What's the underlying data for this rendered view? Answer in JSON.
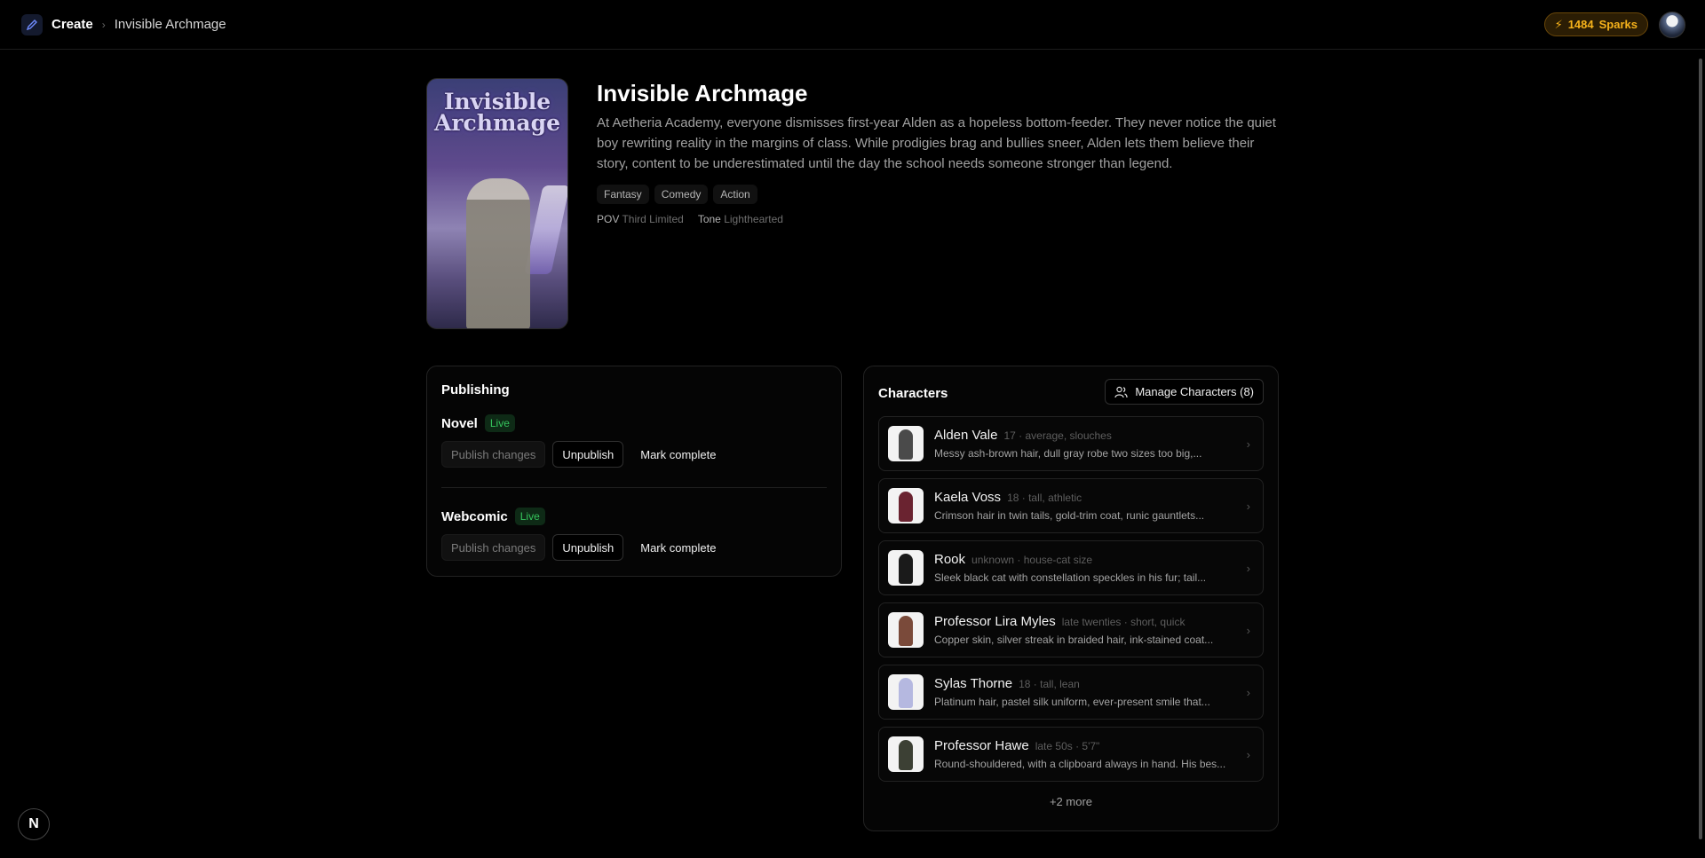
{
  "header": {
    "breadcrumb_root": "Create",
    "breadcrumb_sep": "›",
    "breadcrumb_current": "Invisible Archmage",
    "sparks_count": "1484",
    "sparks_label": "Sparks",
    "spark_color": "#f6b21b"
  },
  "story": {
    "cover_title_line1": "Invisible",
    "cover_title_line2": "Archmage",
    "title": "Invisible Archmage",
    "description": "At Aetheria Academy, everyone dismisses first-year Alden as a hopeless bottom-feeder. They never notice the quiet boy rewriting reality in the margins of class. While prodigies brag and bullies sneer, Alden lets them believe their story, content to be underestimated until the day the school needs someone stronger than legend.",
    "tags": [
      "Fantasy",
      "Comedy",
      "Action"
    ],
    "pov_label": "POV",
    "pov_value": "Third Limited",
    "tone_label": "Tone",
    "tone_value": "Lighthearted"
  },
  "publishing": {
    "title": "Publishing",
    "live_color": "#35c45c",
    "rows": [
      {
        "name": "Novel",
        "status": "Live",
        "publish": "Publish changes",
        "unpublish": "Unpublish",
        "complete": "Mark complete"
      },
      {
        "name": "Webcomic",
        "status": "Live",
        "publish": "Publish changes",
        "unpublish": "Unpublish",
        "complete": "Mark complete"
      }
    ]
  },
  "characters": {
    "title": "Characters",
    "manage_label": "Manage Characters (8)",
    "more_label": "+2 more",
    "items": [
      {
        "name": "Alden Vale",
        "attrs": "17 · average, slouches",
        "desc": "Messy ash-brown hair, dull gray robe two sizes too big,..."
      },
      {
        "name": "Kaela Voss",
        "attrs": "18 · tall, athletic",
        "desc": "Crimson hair in twin tails, gold-trim coat, runic gauntlets..."
      },
      {
        "name": "Rook",
        "attrs": "unknown · house-cat size",
        "desc": "Sleek black cat with constellation speckles in his fur; tail..."
      },
      {
        "name": "Professor Lira Myles",
        "attrs": "late twenties · short, quick",
        "desc": "Copper skin, silver streak in braided hair, ink-stained coat..."
      },
      {
        "name": "Sylas Thorne",
        "attrs": "18 · tall, lean",
        "desc": "Platinum hair, pastel silk uniform, ever-present smile that..."
      },
      {
        "name": "Professor Hawe",
        "attrs": "late 50s · 5'7\"",
        "desc": "Round-shouldered, with a clipboard always in hand. His bes..."
      }
    ]
  },
  "footer": {
    "badge_letter": "N"
  }
}
